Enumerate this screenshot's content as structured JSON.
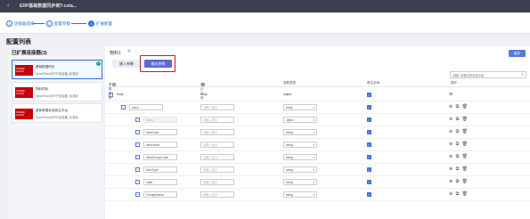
{
  "topbar": {
    "back_icon": "chevron-left-icon",
    "title": "ERP基础数据同步到T-cola..."
  },
  "steps": [
    {
      "num": "1",
      "label": "连接器选择",
      "active": false
    },
    {
      "num": "2",
      "label": "配置参数",
      "active": false
    },
    {
      "num": "3",
      "label": "扩展配置",
      "active": true
    }
  ],
  "page": {
    "title": "配置列表"
  },
  "left": {
    "title": "已扩展连接器(3)",
    "cards": [
      {
        "logo": "HUAWEI CLOUD",
        "name": "基础数据同步",
        "sub": "SparkPack对ERP连接器_标准版",
        "selected": true,
        "checked": true
      },
      {
        "logo": "HUAWEI CLOUD",
        "name": "物料同步",
        "sub": "SparkPack对ERP连接器_标准版",
        "selected": false,
        "checked": false
      },
      {
        "logo": "HUAWEI CLOUD",
        "name": "更新单据状态到云平台",
        "sub": "SparkPack对ERP连接器_标准版",
        "selected": false,
        "checked": false
      }
    ]
  },
  "right": {
    "name": "物料1",
    "edit_icon": "edit-icon",
    "tab_in": "输入参数",
    "tab_out": "输出参数",
    "save": "保存",
    "search_placeholder": "请输入参数名称或显示值",
    "columns": {
      "name": "参数名称",
      "display": "显示字段",
      "type": "参数类型",
      "required": "是否必填",
      "ops": "操作"
    },
    "rows": [
      {
        "name": "body",
        "display": "body",
        "type": "object",
        "level": 0,
        "toggle": "−",
        "edit": false
      },
      {
        "name": "value",
        "display": "请输入显示",
        "type": "array",
        "level": 1,
        "toggle": "−",
        "edit": true
      },
      {
        "name": "items",
        "display": "请输入显示",
        "type": "object",
        "level": 2,
        "toggle": "−",
        "edit": true,
        "grey": true
      },
      {
        "name": "ItemCode",
        "display": "请输入显示",
        "type": "string",
        "level": 3,
        "toggle": "",
        "edit": true
      },
      {
        "name": "ItemName",
        "display": "请输入显示",
        "type": "string",
        "level": 3,
        "toggle": "",
        "edit": true
      },
      {
        "name": "ItemsGroupCode",
        "display": "请输入显示",
        "type": "string",
        "level": 3,
        "toggle": "",
        "edit": true
      },
      {
        "name": "ItemType",
        "display": "请输入显示",
        "type": "string",
        "level": 3,
        "toggle": "",
        "edit": true
      },
      {
        "name": "Valid",
        "display": "请输入显示",
        "type": "string",
        "level": 3,
        "toggle": "",
        "edit": true
      },
      {
        "name": "ForeignName",
        "display": "请输入显示",
        "type": "string",
        "level": 3,
        "toggle": "",
        "edit": true
      }
    ]
  }
}
